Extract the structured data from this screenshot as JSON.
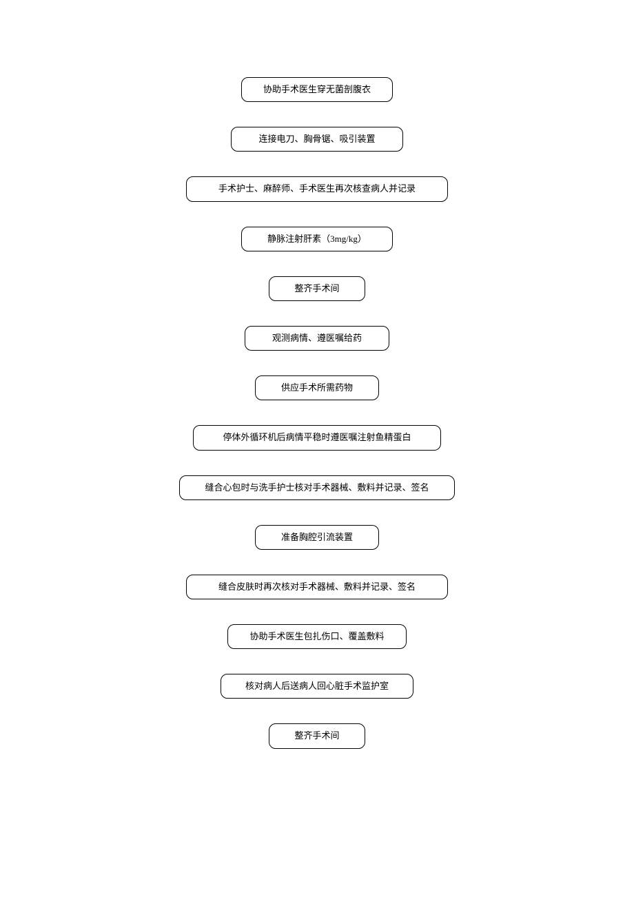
{
  "flowchart": {
    "steps": [
      "协助手术医生穿无菌剖腹衣",
      "连接电刀、胸骨锯、吸引装置",
      "手术护士、麻醉师、手术医生再次核查病人并记录",
      "静脉注射肝素（3mg/kg）",
      "整齐手术间",
      "观测病情、遵医嘱给药",
      "供应手术所需药物",
      "停体外循环机后病情平稳时遵医嘱注射鱼精蛋白",
      "缝合心包时与洗手护士核对手术器械、敷料并记录、签名",
      "准备胸腔引流装置",
      "缝合皮肤时再次核对手术器械、敷料并记录、签名",
      "协助手术医生包扎伤口、覆盖敷料",
      "核对病人后送病人回心脏手术监护室",
      "整齐手术间"
    ]
  }
}
